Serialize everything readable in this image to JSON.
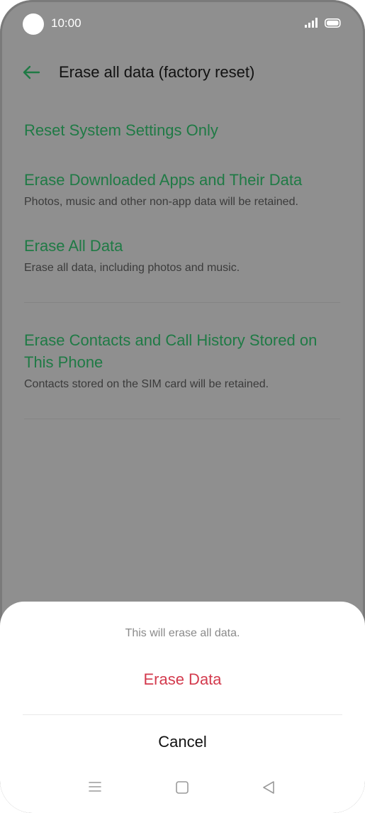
{
  "status_bar": {
    "time": "10:00"
  },
  "header": {
    "title": "Erase all data (factory reset)"
  },
  "options": [
    {
      "title": "Reset System Settings Only",
      "subtitle": ""
    },
    {
      "title": "Erase Downloaded Apps and Their Data",
      "subtitle": "Photos, music and other non-app data will be retained."
    },
    {
      "title": "Erase All Data",
      "subtitle": "Erase all data, including photos and music."
    },
    {
      "title_line1": "Erase Contacts and Call History Stored on",
      "title_line2": "This Phone",
      "subtitle": "Contacts stored on the SIM card will be retained."
    }
  ],
  "dialog": {
    "message": "This will erase all data.",
    "confirm_label": "Erase Data",
    "cancel_label": "Cancel"
  },
  "icons": {
    "back": "arrow-left-icon",
    "signal": "signal-icon",
    "battery": "battery-icon",
    "nav_menu": "menu-icon",
    "nav_home": "home-icon",
    "nav_back": "triangle-back-icon"
  },
  "colors": {
    "accent_green": "#1f7a45",
    "danger_red": "#d33a4d",
    "scrim": "#8f8f8f"
  }
}
